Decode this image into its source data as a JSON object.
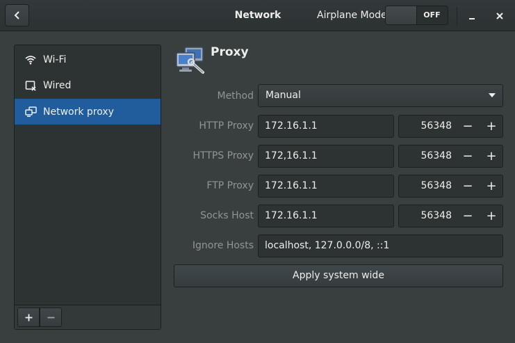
{
  "header": {
    "title": "Network",
    "airplane_label": "Airplane Mode",
    "airplane_state": "OFF",
    "minimize_symbol": "–",
    "close_symbol": "✕"
  },
  "sidebar": {
    "items": [
      {
        "label": "Wi-Fi",
        "icon": "wifi-icon"
      },
      {
        "label": "Wired",
        "icon": "wired-icon"
      },
      {
        "label": "Network proxy",
        "icon": "network-proxy-icon"
      }
    ],
    "add_symbol": "+",
    "remove_symbol": "−"
  },
  "panel": {
    "title": "Proxy",
    "method_label": "Method",
    "method_value": "Manual",
    "rows": [
      {
        "label": "HTTP Proxy",
        "host": "172.16.1.1",
        "port": "56348"
      },
      {
        "label": "HTTPS Proxy",
        "host": "172,16.1.1",
        "port": "56348"
      },
      {
        "label": "FTP Proxy",
        "host": "172.16.1.1",
        "port": "56348"
      },
      {
        "label": "Socks Host",
        "host": "172.16.1.1",
        "port": "56348"
      }
    ],
    "ignore_label": "Ignore Hosts",
    "ignore_value": "localhost, 127.0.0.0/8, ::1",
    "apply_label": "Apply system wide",
    "spin_minus": "−",
    "spin_plus": "+"
  },
  "colors": {
    "background": "#393f3f",
    "header": "#2c3132",
    "selection": "#215d9c",
    "entry": "#2d3233",
    "muted_text": "#919494"
  }
}
